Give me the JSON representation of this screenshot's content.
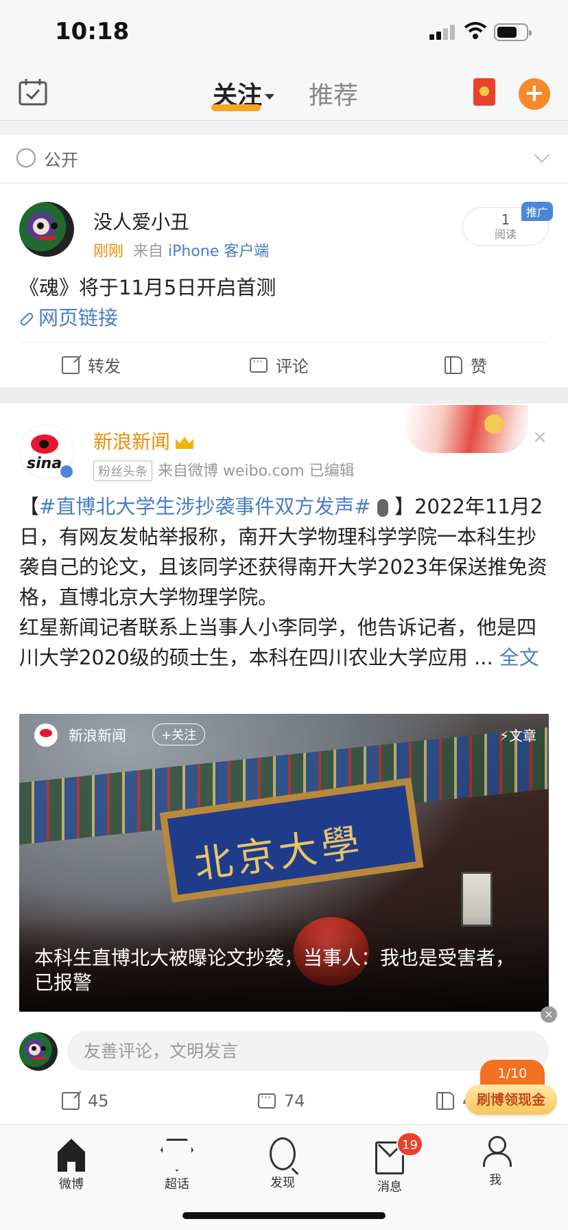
{
  "status_bar": {
    "time": "10:18"
  },
  "top_nav": {
    "tabs": [
      {
        "label": "关注",
        "active": true
      },
      {
        "label": "推荐",
        "active": false
      }
    ],
    "plus": "+"
  },
  "visibility": {
    "label": "公开"
  },
  "post1": {
    "user_name": "没人爱小丑",
    "time": "刚刚",
    "source_prefix": "来自",
    "source_app": "iPhone 客户端",
    "read_count": "1",
    "read_label": "阅读",
    "promo_tag": "推广",
    "text": "《魂》将于11月5日开启首测",
    "link_text": "网页链接",
    "actions": {
      "repost": "转发",
      "comment": "评论",
      "like": "赞"
    }
  },
  "post2": {
    "user_name": "新浪新闻",
    "logo_text": "sina",
    "fan_tag": "粉丝头条",
    "meta_text": "来自微博 weibo.com  已编辑",
    "text_open": "【",
    "hashtag": "#直博北大学生涉抄袭事件双方发声#",
    "text_close": "】",
    "text_body": "2022年11月2日，有网友发帖举报称，南开大学物理科学学院一本科生抄袭自己的论文，且该同学还获得南开大学2023年保送推免资格，直博北京大学物理学院。\n红星新闻记者联系上当事人小李同学，他告诉记者，他是四川大学2020级的硕士生，本科在四川农业大学应用 ... ",
    "more": "全文",
    "close": "×",
    "media": {
      "source_name": "新浪新闻",
      "follow_label": "+关注",
      "article_tag": "⚡文章",
      "plaque_text": "北京大學",
      "caption": "本科生直博北大被曝论文抄袭，当事人：我也是受害者，已报警",
      "close": "×"
    },
    "comment_placeholder": "友善评论，文明发言",
    "counts": {
      "repost": "45",
      "comment": "74",
      "like": "400"
    }
  },
  "floating": {
    "counter": "1/10",
    "cash_label": "刷博领现金"
  },
  "tab_bar": {
    "items": [
      {
        "label": "微博",
        "icon": "home-icon"
      },
      {
        "label": "超话",
        "icon": "diamond-icon"
      },
      {
        "label": "发现",
        "icon": "search-icon"
      },
      {
        "label": "消息",
        "icon": "mail-icon"
      },
      {
        "label": "我",
        "icon": "person-icon"
      }
    ],
    "message_badge": "19"
  },
  "colors": {
    "accent_orange": "#f08c00",
    "link_blue": "#4a7ec6",
    "badge_red": "#e8412c"
  }
}
